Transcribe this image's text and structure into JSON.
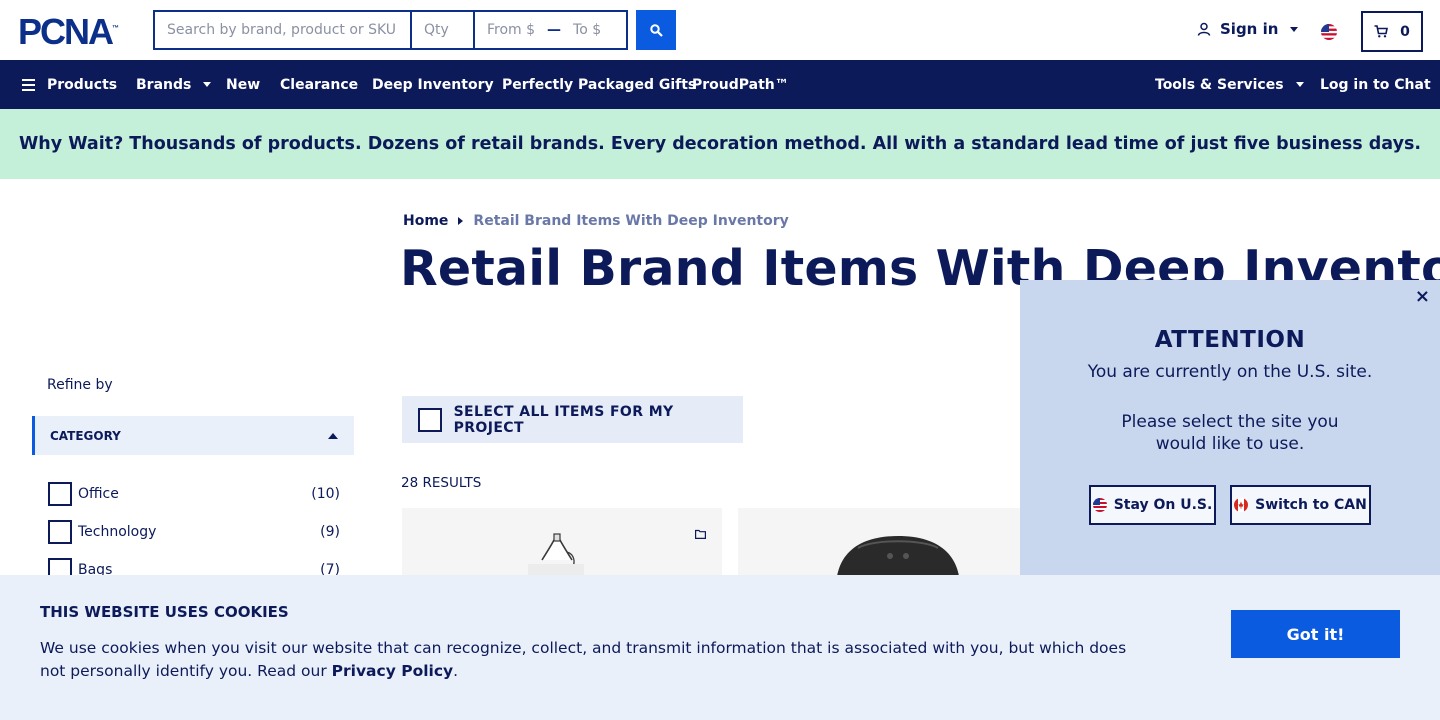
{
  "header": {
    "logo": "PCNA",
    "logo_mark": "™",
    "search_placeholder": "Search by brand, product or SKU",
    "qty_placeholder": "Qty",
    "from_placeholder": "From $",
    "to_placeholder": "To $",
    "sign_in": "Sign in",
    "cart_count": "0"
  },
  "nav": {
    "items": [
      "Products",
      "Brands",
      "New",
      "Clearance",
      "Deep Inventory",
      "Perfectly Packaged Gifts",
      "ProudPath™"
    ],
    "tools": "Tools & Services",
    "chat": "Log in to Chat"
  },
  "banner": "Why Wait? Thousands of products. Dozens of retail brands. Every decoration method. All with a standard lead time of just five business days.",
  "breadcrumb": {
    "home": "Home",
    "current": "Retail Brand Items With Deep Inventory"
  },
  "page_title": "Retail Brand Items With Deep Inventory",
  "sidebar": {
    "refine": "Refine by",
    "category_header": "CATEGORY",
    "categories": [
      {
        "label": "Office",
        "count": "(10)"
      },
      {
        "label": "Technology",
        "count": "(9)"
      },
      {
        "label": "Bags",
        "count": "(7)"
      }
    ]
  },
  "main": {
    "select_all": "SELECT ALL ITEMS FOR MY PROJECT",
    "results": "28 RESULTS"
  },
  "modal": {
    "heading": "ATTENTION",
    "line1": "You are currently on the U.S. site.",
    "line2": "Please select the site you would like to use.",
    "stay_us": "Stay On U.S.",
    "switch_can": "Switch to CAN",
    "close": "×"
  },
  "cookie": {
    "title": "THIS WEBSITE USES COOKIES",
    "text": "We use cookies when you visit our website that can recognize, collect, and transmit information that is associated with you, but which does not personally identify you. Read our ",
    "link": "Privacy Policy",
    "end": ".",
    "button": "Got it!"
  },
  "colors": {
    "navy": "#0c1a5a",
    "accent": "#0a5be0",
    "banner": "#c4efd8",
    "modal": "#c8d6ee",
    "cookie": "#eaf0fa"
  }
}
